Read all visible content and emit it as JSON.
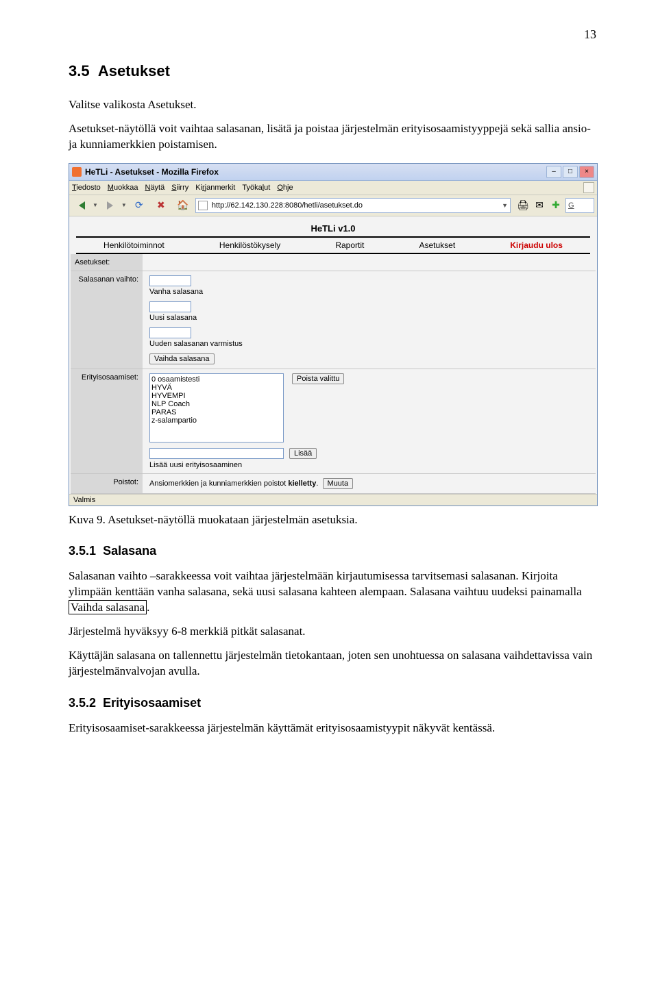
{
  "page_number": "13",
  "section": {
    "number": "3.5",
    "title": "Asetukset"
  },
  "intro1": "Valitse valikosta Asetukset.",
  "intro2": "Asetukset-näytöllä voit vaihtaa salasanan, lisätä ja poistaa järjestelmän erityisosaamistyyppejä sekä sallia ansio- ja kunniamerkkien poistamisen.",
  "figure_caption": "Kuva 9. Asetukset-näytöllä muokataan järjestelmän asetuksia.",
  "sub1": {
    "number": "3.5.1",
    "title": "Salasana"
  },
  "sub1_p1a": "Salasanan vaihto –sarakkeessa voit vaihtaa järjestelmään kirjautumisessa tarvitsemasi salasanan. Kirjoita ylimpään kenttään vanha salasana, sekä uusi salasana kahteen alempaan. Salasana vaihtuu uudeksi painamalla ",
  "sub1_p1_box": "Vaihda salasana",
  "sub1_p1b": ".",
  "sub1_p2": "Järjestelmä hyväksyy 6-8 merkkiä pitkät salasanat.",
  "sub1_p3": "Käyttäjän salasana on tallennettu järjestelmän tietokantaan, joten sen unohtuessa on salasana vaihdettavissa vain järjestelmänvalvojan avulla.",
  "sub2": {
    "number": "3.5.2",
    "title": "Erityisosaamiset"
  },
  "sub2_p1": "Erityisosaamiset-sarakkeessa järjestelmän käyttämät erityisosaamistyypit näkyvät kentässä.",
  "firefox": {
    "title": "HeTLi - Asetukset - Mozilla Firefox",
    "menus": [
      "Tiedosto",
      "Muokkaa",
      "Näytä",
      "Siirry",
      "Kirjanmerkit",
      "Työkalut",
      "Ohje"
    ],
    "url": "http://62.142.130.228:8080/hetli/asetukset.do",
    "search_hint": "G",
    "status": "Valmis"
  },
  "hetli": {
    "version": "HeTLi v1.0",
    "nav": [
      "Henkilötoiminnot",
      "Henkilöstökysely",
      "Raportit",
      "Asetukset"
    ],
    "nav_logout": "Kirjaudu ulos",
    "settings_label": "Asetukset:",
    "pw": {
      "section_label": "Salasanan vaihto:",
      "old_label": "Vanha salasana",
      "new_label": "Uusi salasana",
      "confirm_label": "Uuden salasanan varmistus",
      "button": "Vaihda salasana"
    },
    "skills": {
      "section_label": "Erityisosaamiset:",
      "options": [
        "0 osaamistesti",
        "HYVÄ",
        "HYVEMPI",
        "NLP Coach",
        "PARAS",
        "z-salampartio"
      ],
      "remove_btn": "Poista valittu",
      "add_btn": "Lisää",
      "add_label": "Lisää uusi erityisosaaminen"
    },
    "removals": {
      "section_label": "Poistot:",
      "text_a": "Ansiomerkkien ja kunniamerkkien poistot ",
      "text_b": "kielletty",
      "text_c": ".",
      "button": "Muuta"
    }
  }
}
